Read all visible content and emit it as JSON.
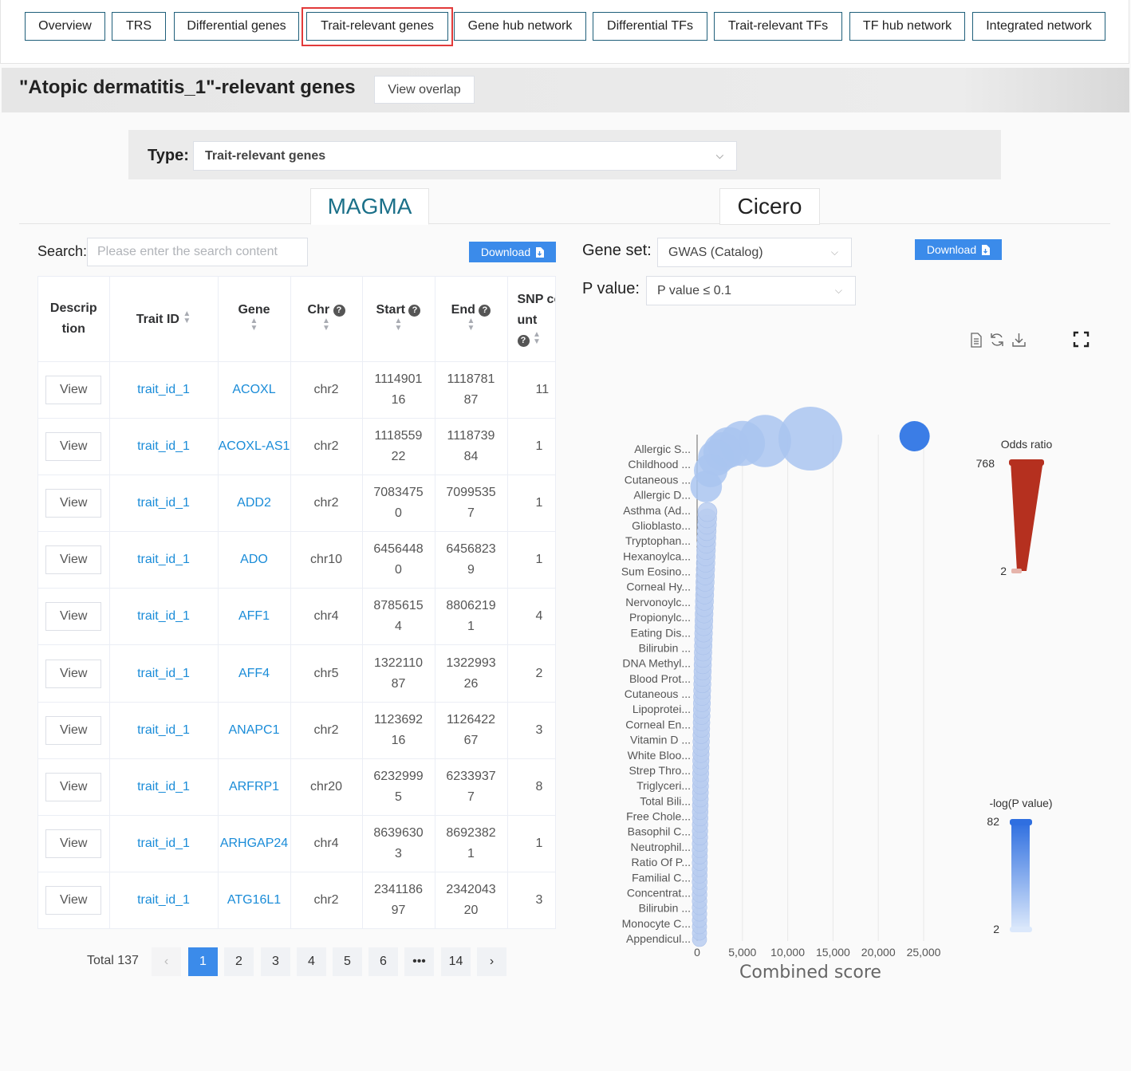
{
  "nav": {
    "tabs": [
      "Overview",
      "TRS",
      "Differential genes",
      "Trait-relevant genes",
      "Gene hub network",
      "Differential TFs",
      "Trait-relevant TFs",
      "TF hub network",
      "Integrated network"
    ],
    "active": "Trait-relevant genes"
  },
  "header": {
    "title": "\"Atopic dermatitis_1\"-relevant genes",
    "overlap_button": "View overlap"
  },
  "type_filter": {
    "label": "Type:",
    "value": "Trait-relevant genes"
  },
  "method_tabs": {
    "magma": "MAGMA",
    "cicero": "Cicero",
    "active": "MAGMA"
  },
  "search": {
    "label": "Search:",
    "placeholder": "Please enter the search content"
  },
  "download_label": "Download",
  "table": {
    "columns": [
      "Description",
      "Trait ID",
      "Gene",
      "Chr",
      "Start",
      "End",
      "SNP count"
    ],
    "view_label": "View",
    "rows": [
      {
        "trait_id": "trait_id_1",
        "gene": "ACOXL",
        "chr": "chr2",
        "start": "111490116",
        "end": "111878187",
        "snp": "11"
      },
      {
        "trait_id": "trait_id_1",
        "gene": "ACOXL-AS1",
        "chr": "chr2",
        "start": "111855922",
        "end": "111873984",
        "snp": "1"
      },
      {
        "trait_id": "trait_id_1",
        "gene": "ADD2",
        "chr": "chr2",
        "start": "70834750",
        "end": "70995357",
        "snp": "1"
      },
      {
        "trait_id": "trait_id_1",
        "gene": "ADO",
        "chr": "chr10",
        "start": "64564480",
        "end": "64568239",
        "snp": "1"
      },
      {
        "trait_id": "trait_id_1",
        "gene": "AFF1",
        "chr": "chr4",
        "start": "87856154",
        "end": "88062191",
        "snp": "4"
      },
      {
        "trait_id": "trait_id_1",
        "gene": "AFF4",
        "chr": "chr5",
        "start": "132211087",
        "end": "132299326",
        "snp": "2"
      },
      {
        "trait_id": "trait_id_1",
        "gene": "ANAPC1",
        "chr": "chr2",
        "start": "112369216",
        "end": "112642267",
        "snp": "3"
      },
      {
        "trait_id": "trait_id_1",
        "gene": "ARFRP1",
        "chr": "chr20",
        "start": "62329995",
        "end": "62339377",
        "snp": "8"
      },
      {
        "trait_id": "trait_id_1",
        "gene": "ARHGAP24",
        "chr": "chr4",
        "start": "86396303",
        "end": "86923821",
        "snp": "1"
      },
      {
        "trait_id": "trait_id_1",
        "gene": "ATG16L1",
        "chr": "chr2",
        "start": "234118697",
        "end": "234204320",
        "snp": "3"
      }
    ]
  },
  "pagination": {
    "total": "Total 137",
    "pages": [
      "1",
      "2",
      "3",
      "4",
      "5",
      "6",
      "•••",
      "14"
    ],
    "current": "1",
    "prev": "‹",
    "next": "›"
  },
  "controls": {
    "gene_set_label": "Gene set:",
    "gene_set_value": "GWAS (Catalog)",
    "pvalue_label": "P value:",
    "pvalue_value": "P value ≤ 0.1"
  },
  "toolbar_icons": [
    "data-view-icon",
    "refresh-icon",
    "save-image-icon",
    "fullscreen-icon"
  ],
  "chart_data": {
    "type": "scatter",
    "xlabel": "Combined score",
    "xticks": [
      "0",
      "5,000",
      "10,000",
      "15,000",
      "20,000",
      "25,000"
    ],
    "xlim": [
      0,
      25000
    ],
    "categories": [
      "Allergic S...",
      "Childhood ...",
      "Cutaneous ...",
      "Allergic D...",
      "Asthma (Ad...",
      "Glioblasto...",
      "Tryptophan...",
      "Hexanoylca...",
      "Sum Eosino...",
      "Corneal Hy...",
      "Nervonoylc...",
      "Propionylc...",
      "Eating Dis...",
      "Bilirubin ...",
      "DNA Methyl...",
      "Blood Prot...",
      "Cutaneous ...",
      "Lipoprotei...",
      "Corneal En...",
      "Vitamin D ...",
      "White Bloo...",
      "Strep Thro...",
      "Triglyceri...",
      "Total Bili...",
      "Free Chole...",
      "Basophil C...",
      "Neutrophil...",
      "Ratio Of P...",
      "Familial C...",
      "Concentrat...",
      "Bilirubin ...",
      "Monocyte C...",
      "Appendicul..."
    ],
    "points": [
      {
        "x": 12500,
        "size": 768,
        "color": "light"
      },
      {
        "x": 7500,
        "size": 420,
        "color": "light"
      },
      {
        "x": 5000,
        "size": 260,
        "color": "light"
      },
      {
        "x": 3500,
        "size": 180,
        "color": "light"
      },
      {
        "x": 2800,
        "size": 140,
        "color": "light"
      },
      {
        "x": 2100,
        "size": 110,
        "color": "light"
      },
      {
        "x": 1500,
        "size": 80,
        "color": "light"
      },
      {
        "x": 1000,
        "size": 60,
        "color": "light"
      },
      {
        "x": 24000,
        "size": 2,
        "color": "dark"
      }
    ],
    "legend_odds": {
      "title": "Odds ratio",
      "max": "768",
      "min": "2",
      "color": "#b5301f"
    },
    "legend_p": {
      "title": "-log(P value)",
      "max": "82",
      "min": "2",
      "color": "#2f6fe0"
    }
  }
}
